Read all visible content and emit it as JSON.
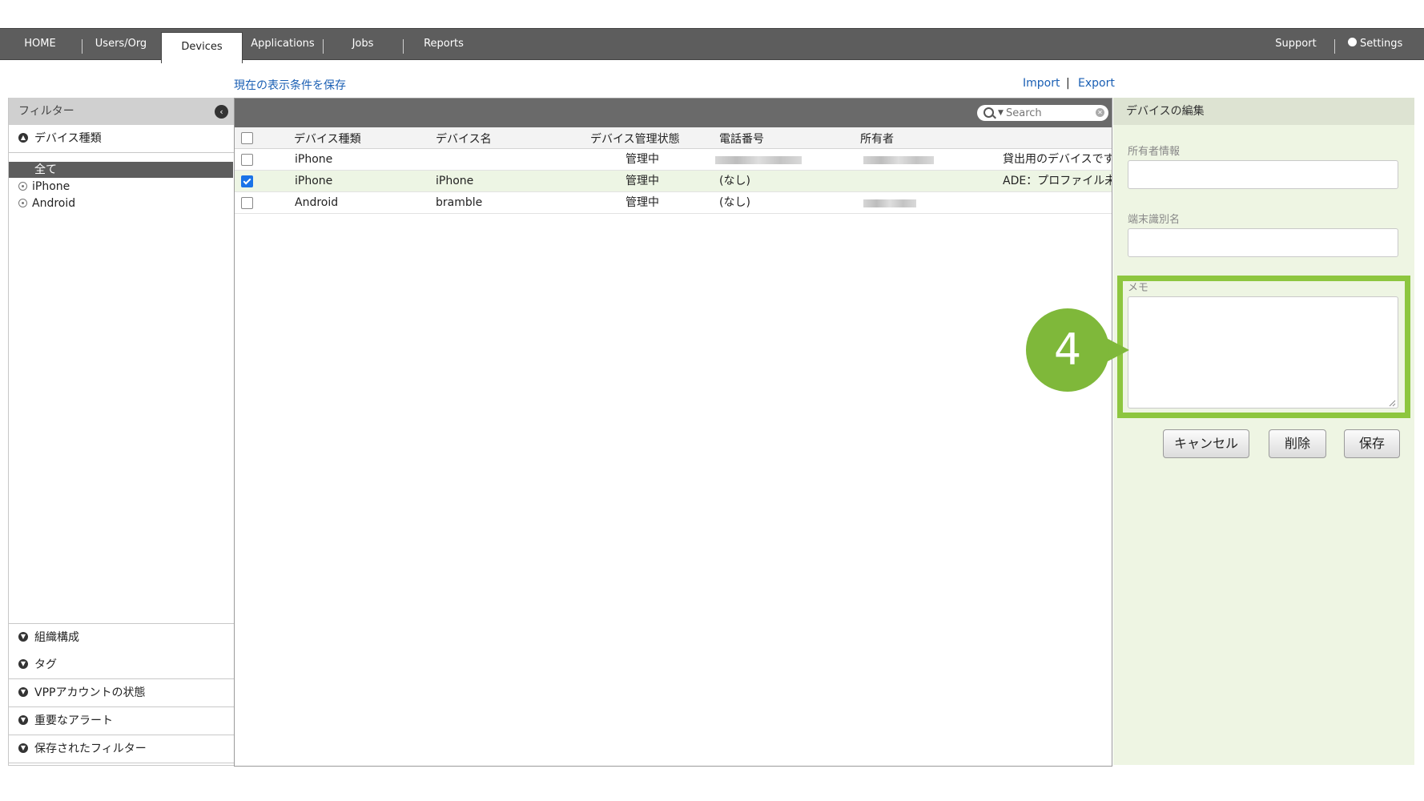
{
  "nav": {
    "tabs": [
      {
        "label": "HOME"
      },
      {
        "label": "Users/Org"
      },
      {
        "label": "Devices"
      },
      {
        "label": "Applications"
      },
      {
        "label": "Jobs"
      },
      {
        "label": "Reports"
      }
    ],
    "support_label": "Support",
    "settings_label": "Settings"
  },
  "links": {
    "save_view": "現在の表示条件を保存",
    "import": "Import",
    "separator": "|",
    "export": "Export"
  },
  "filter": {
    "title": "フィルター",
    "device_type": {
      "title": "デバイス種類",
      "options": [
        {
          "label": "全て",
          "selected": true
        },
        {
          "label": "iPhone"
        },
        {
          "label": "Android"
        }
      ]
    },
    "sections": [
      {
        "label": "組織構成"
      },
      {
        "label": "タグ"
      },
      {
        "label": "VPPアカウントの状態"
      },
      {
        "label": "重要なアラート"
      },
      {
        "label": "保存されたフィルター"
      }
    ]
  },
  "search": {
    "placeholder": "Search"
  },
  "table": {
    "columns": [
      "デバイス種類",
      "デバイス名",
      "デバイス管理状態",
      "電話番号",
      "所有者"
    ],
    "rows": [
      {
        "type": "iPhone",
        "name": "",
        "status": "管理中",
        "phone": "",
        "owner": "",
        "note": "貸出用のデバイスです",
        "checked": false
      },
      {
        "type": "iPhone",
        "name": "iPhone",
        "status": "管理中",
        "phone": "(なし)",
        "owner": "",
        "note": "ADE：プロファイル未",
        "checked": true
      },
      {
        "type": "Android",
        "name": "bramble",
        "status": "管理中",
        "phone": "(なし)",
        "owner": "",
        "note": "",
        "checked": false
      }
    ]
  },
  "edit": {
    "title": "デバイスの編集",
    "owner_label": "所有者情報",
    "device_id_label": "端末識別名",
    "memo_label": "メモ",
    "cancel": "キャンセル",
    "delete": "削除",
    "save": "保存"
  },
  "annotation": {
    "step": "4",
    "color": "#8dc63f"
  },
  "colors": {
    "nav_bg": "#5d5d5d",
    "link": "#1a5fb4",
    "panel_bg": "#eef5e3",
    "accent": "#8dc63f"
  }
}
